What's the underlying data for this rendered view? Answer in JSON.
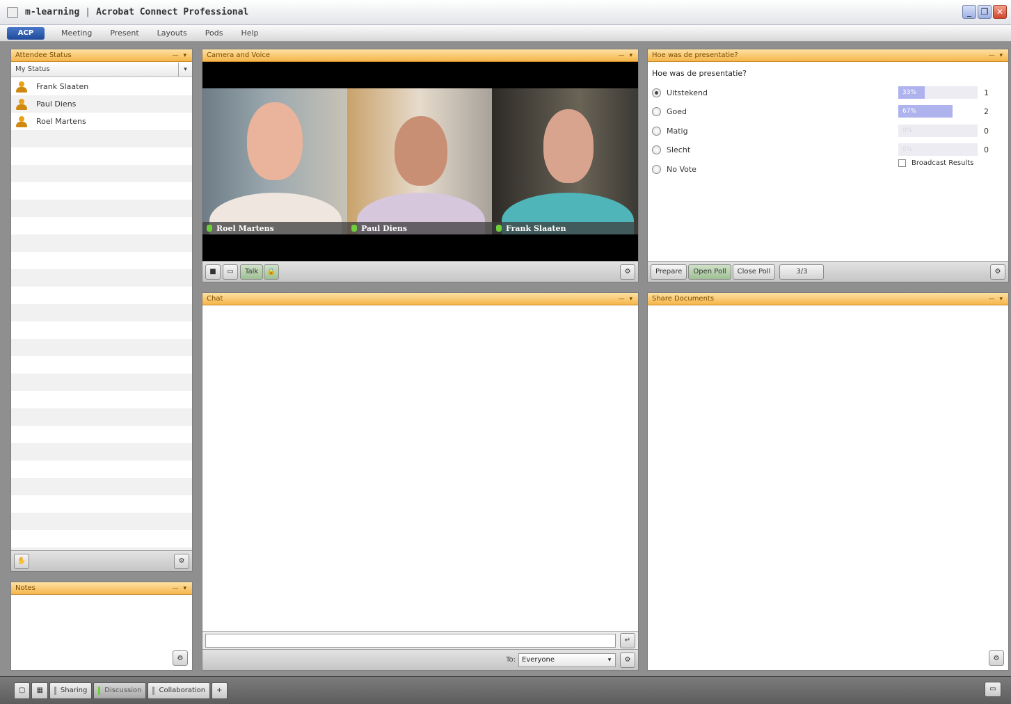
{
  "window": {
    "app_name": "m-learning",
    "title": "Acrobat Connect Professional"
  },
  "menu": {
    "logo_label": "ACP",
    "items": [
      "Meeting",
      "Present",
      "Layouts",
      "Pods",
      "Help"
    ]
  },
  "attendees": {
    "title": "Attendee Status",
    "status_placeholder": "My Status",
    "people": [
      "Frank Slaaten",
      "Paul Diens",
      "Roel Martens"
    ]
  },
  "video": {
    "title": "Camera and Voice",
    "participants": [
      "Roel Martens",
      "Paul Diens",
      "Frank Slaaten"
    ],
    "talk_label": "Talk"
  },
  "poll": {
    "title": "Hoe was de presentatie?",
    "question": "Hoe was de presentatie?",
    "options": [
      {
        "label": "Uitstekend",
        "percent": 33,
        "count": 1,
        "checked": true
      },
      {
        "label": "Goed",
        "percent": 67,
        "count": 2,
        "checked": false
      },
      {
        "label": "Matig",
        "percent": 0,
        "count": 0,
        "checked": false
      },
      {
        "label": "Slecht",
        "percent": 0,
        "count": 0,
        "checked": false
      },
      {
        "label": "No Vote",
        "percent": null,
        "count": null,
        "checked": false
      }
    ],
    "percent_labels": [
      "33%",
      "67%",
      "0%",
      "0%"
    ],
    "counts": [
      "1",
      "2",
      "0",
      "0"
    ],
    "broadcast_label": "Broadcast Results",
    "prepare_label": "Prepare",
    "open_label": "Open Poll",
    "close_label": "Close Poll",
    "votes_label": "3/3"
  },
  "chat": {
    "title": "Chat",
    "to_label": "To:",
    "recipient": "Everyone"
  },
  "notes": {
    "title": "Notes"
  },
  "right_bottom_pod": {
    "title": "Share Documents"
  },
  "tabs": {
    "items": [
      "Sharing",
      "Discussion",
      "Collaboration"
    ],
    "active": "Discussion",
    "add_label": "+"
  },
  "colors": {
    "pod_header": "#f5b54a",
    "poll_bar": "#aeb3ee",
    "mic_green": "#6fcf3c"
  }
}
